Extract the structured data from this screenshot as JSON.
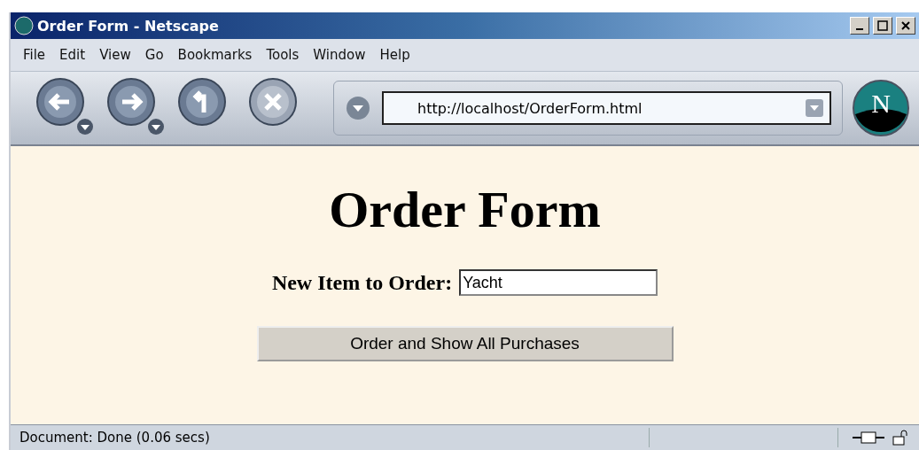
{
  "window": {
    "title": "Order Form - Netscape"
  },
  "menu": [
    "File",
    "Edit",
    "View",
    "Go",
    "Bookmarks",
    "Tools",
    "Window",
    "Help"
  ],
  "toolbar": {
    "url": "http://localhost/OrderForm.html",
    "logo_letter": "N"
  },
  "page": {
    "heading": "Order Form",
    "field_label": "New Item to Order:",
    "field_value": "Yacht",
    "button": "Order and Show All Purchases"
  },
  "status_bar": {
    "text": "Document: Done (0.06 secs)"
  }
}
